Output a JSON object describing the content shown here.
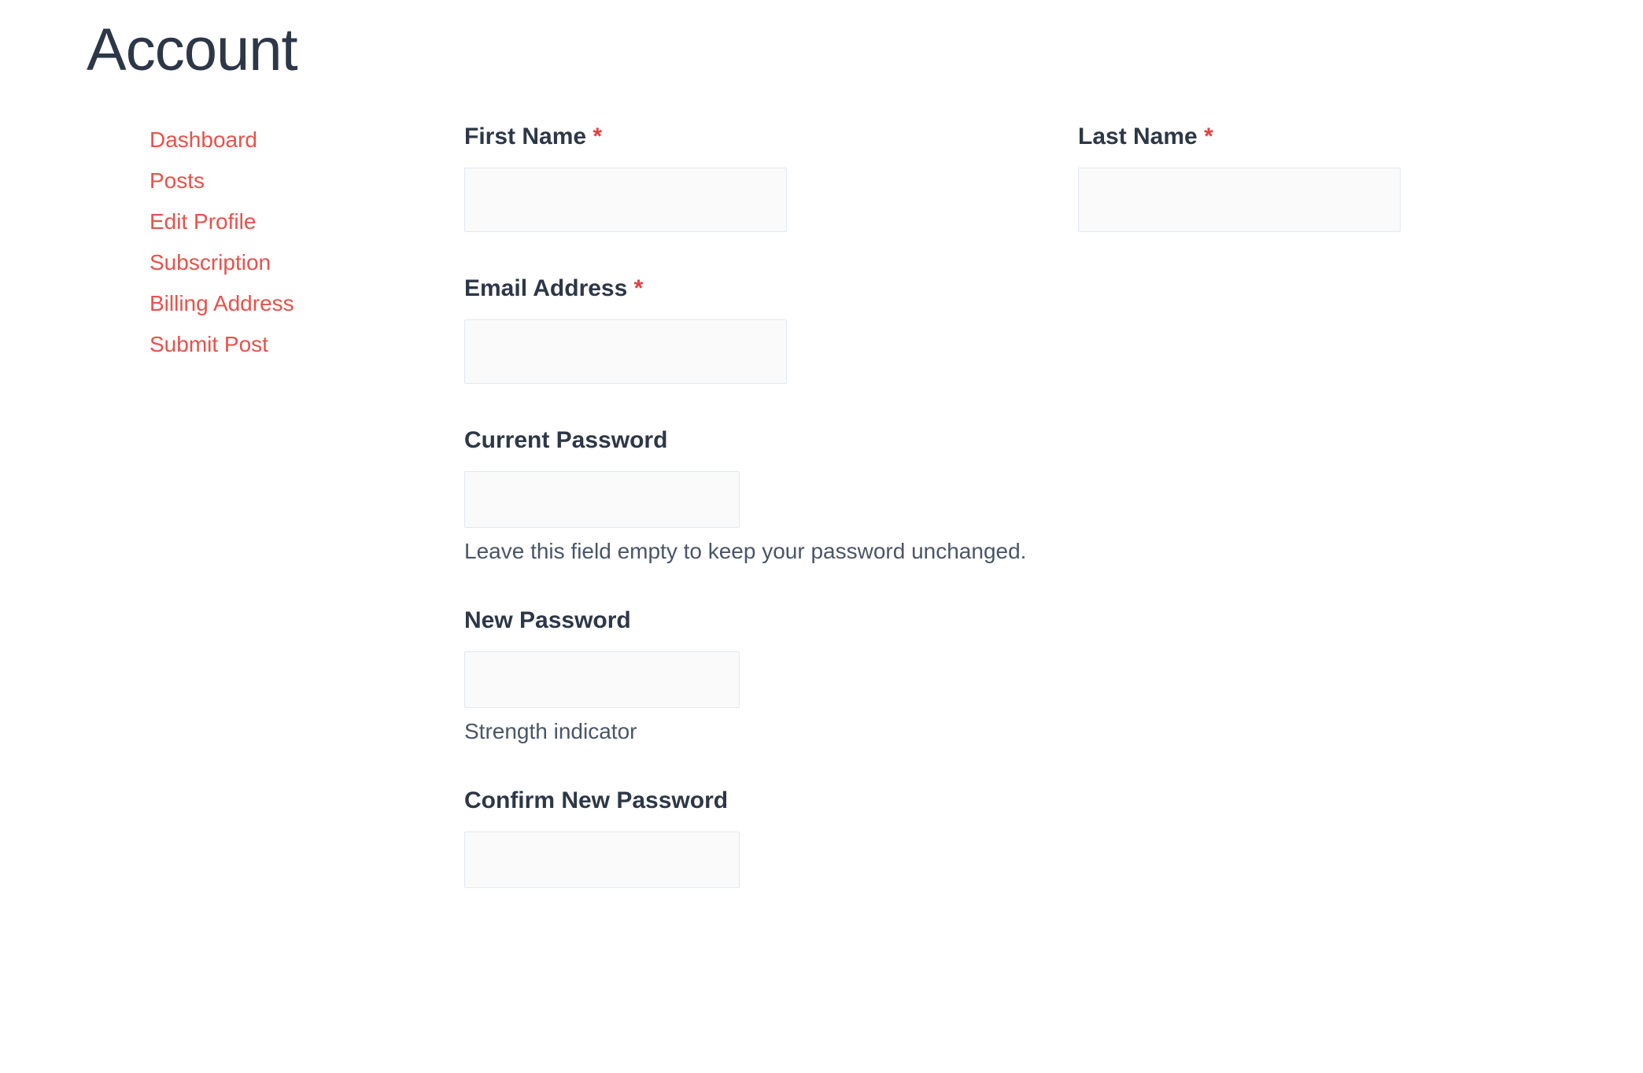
{
  "page": {
    "title": "Account"
  },
  "sidebar": {
    "items": [
      {
        "label": "Dashboard"
      },
      {
        "label": "Posts"
      },
      {
        "label": "Edit Profile"
      },
      {
        "label": "Subscription"
      },
      {
        "label": "Billing Address"
      },
      {
        "label": "Submit Post"
      }
    ]
  },
  "form": {
    "first_name": {
      "label": "First Name",
      "required": "*",
      "value": ""
    },
    "last_name": {
      "label": "Last Name",
      "required": "*",
      "value": ""
    },
    "email": {
      "label": "Email Address",
      "required": "*",
      "value": ""
    },
    "current_password": {
      "label": "Current Password",
      "value": "",
      "help_text": "Leave this field empty to keep your password unchanged."
    },
    "new_password": {
      "label": "New Password",
      "value": "",
      "help_text": "Strength indicator"
    },
    "confirm_password": {
      "label": "Confirm New Password",
      "value": ""
    }
  }
}
